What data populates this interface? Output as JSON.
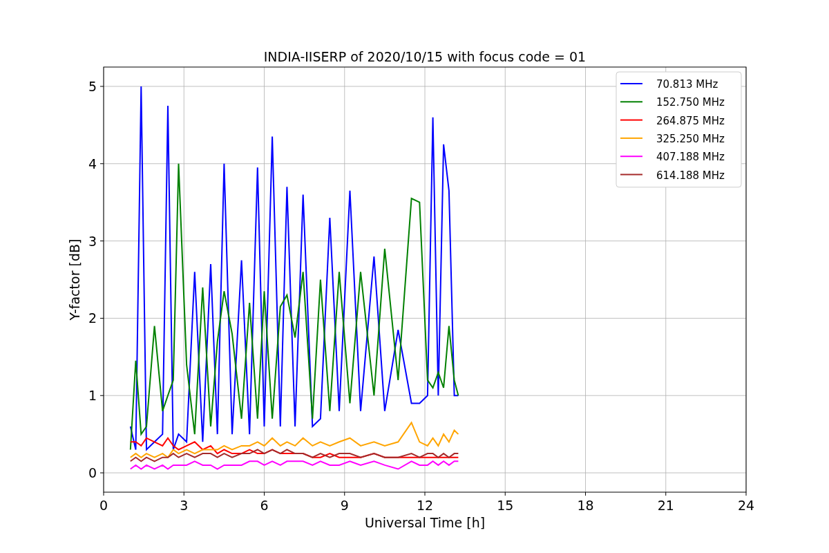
{
  "chart": {
    "chart_data": {
      "type": "line",
      "title": "INDIA-IISERP of 2020/10/15 with focus code = 01",
      "xlabel": "Universal Time [h]",
      "ylabel": "Y-factor [dB]",
      "x": [
        1.0,
        1.2,
        1.4,
        1.6,
        1.9,
        2.2,
        2.4,
        2.6,
        2.8,
        3.1,
        3.4,
        3.7,
        4.0,
        4.25,
        4.5,
        4.8,
        5.15,
        5.45,
        5.75,
        6.0,
        6.3,
        6.6,
        6.85,
        7.15,
        7.45,
        7.8,
        8.1,
        8.45,
        8.8,
        9.2,
        9.6,
        10.1,
        10.5,
        11.0,
        11.5,
        11.8,
        12.1,
        12.3,
        12.5,
        12.7,
        12.9,
        13.1,
        13.25
      ],
      "series": [
        {
          "name": "70.813 MHz",
          "color": "#0000ff",
          "values": [
            0.6,
            0.3,
            5.0,
            0.3,
            0.4,
            0.5,
            4.75,
            0.3,
            0.5,
            0.4,
            2.6,
            0.4,
            2.7,
            0.5,
            4.0,
            0.5,
            2.75,
            0.5,
            3.95,
            0.6,
            4.35,
            0.6,
            3.7,
            0.6,
            3.6,
            0.6,
            0.7,
            3.3,
            0.8,
            3.65,
            0.8,
            2.8,
            0.8,
            1.85,
            0.9,
            0.9,
            1.0,
            4.6,
            1.0,
            4.25,
            3.65,
            1.0,
            1.0
          ]
        },
        {
          "name": "152.750 MHz",
          "color": "#008000",
          "values": [
            0.3,
            1.45,
            0.5,
            0.6,
            1.9,
            0.8,
            1.0,
            1.2,
            4.0,
            1.4,
            0.5,
            2.4,
            0.6,
            1.7,
            2.35,
            1.8,
            0.7,
            2.2,
            0.7,
            2.35,
            0.7,
            2.15,
            2.3,
            1.75,
            2.6,
            0.7,
            2.5,
            0.8,
            2.6,
            0.9,
            2.6,
            1.0,
            2.9,
            1.2,
            3.55,
            3.5,
            1.2,
            1.1,
            1.3,
            1.1,
            1.9,
            1.2,
            1.0
          ]
        },
        {
          "name": "264.875 MHz",
          "color": "#ff0000",
          "values": [
            0.4,
            0.4,
            0.35,
            0.45,
            0.4,
            0.35,
            0.45,
            0.35,
            0.3,
            0.35,
            0.4,
            0.3,
            0.35,
            0.25,
            0.3,
            0.25,
            0.25,
            0.3,
            0.25,
            0.25,
            0.3,
            0.25,
            0.25,
            0.25,
            0.25,
            0.2,
            0.2,
            0.25,
            0.2,
            0.2,
            0.2,
            0.25,
            0.2,
            0.2,
            0.2,
            0.2,
            0.2,
            0.2,
            0.2,
            0.2,
            0.2,
            0.2,
            0.2
          ]
        },
        {
          "name": "325.250 MHz",
          "color": "#ffa500",
          "values": [
            0.2,
            0.25,
            0.2,
            0.25,
            0.2,
            0.25,
            0.2,
            0.3,
            0.25,
            0.3,
            0.25,
            0.3,
            0.3,
            0.3,
            0.35,
            0.3,
            0.35,
            0.35,
            0.4,
            0.35,
            0.45,
            0.35,
            0.4,
            0.35,
            0.45,
            0.35,
            0.4,
            0.35,
            0.4,
            0.45,
            0.35,
            0.4,
            0.35,
            0.4,
            0.65,
            0.4,
            0.35,
            0.45,
            0.35,
            0.5,
            0.4,
            0.55,
            0.5
          ]
        },
        {
          "name": "407.188 MHz",
          "color": "#ff00ff",
          "values": [
            0.05,
            0.1,
            0.05,
            0.1,
            0.05,
            0.1,
            0.05,
            0.1,
            0.1,
            0.1,
            0.15,
            0.1,
            0.1,
            0.05,
            0.1,
            0.1,
            0.1,
            0.15,
            0.15,
            0.1,
            0.15,
            0.1,
            0.15,
            0.15,
            0.15,
            0.1,
            0.15,
            0.1,
            0.1,
            0.15,
            0.1,
            0.15,
            0.1,
            0.05,
            0.15,
            0.1,
            0.1,
            0.15,
            0.1,
            0.15,
            0.1,
            0.15,
            0.15
          ]
        },
        {
          "name": "614.188 MHz",
          "color": "#a52a2a",
          "values": [
            0.15,
            0.2,
            0.15,
            0.2,
            0.15,
            0.2,
            0.2,
            0.25,
            0.2,
            0.25,
            0.2,
            0.25,
            0.25,
            0.2,
            0.25,
            0.2,
            0.25,
            0.25,
            0.3,
            0.25,
            0.3,
            0.25,
            0.3,
            0.25,
            0.25,
            0.2,
            0.25,
            0.2,
            0.25,
            0.25,
            0.2,
            0.25,
            0.2,
            0.2,
            0.25,
            0.2,
            0.25,
            0.25,
            0.2,
            0.25,
            0.2,
            0.25,
            0.25
          ]
        }
      ],
      "grid": true,
      "legend": true,
      "xlim": [
        0,
        24
      ],
      "ylim": [
        -0.25,
        5.25
      ],
      "xticks": [
        0,
        3,
        6,
        9,
        12,
        15,
        18,
        21,
        24
      ],
      "yticks": [
        0,
        1,
        2,
        3,
        4,
        5
      ]
    }
  }
}
